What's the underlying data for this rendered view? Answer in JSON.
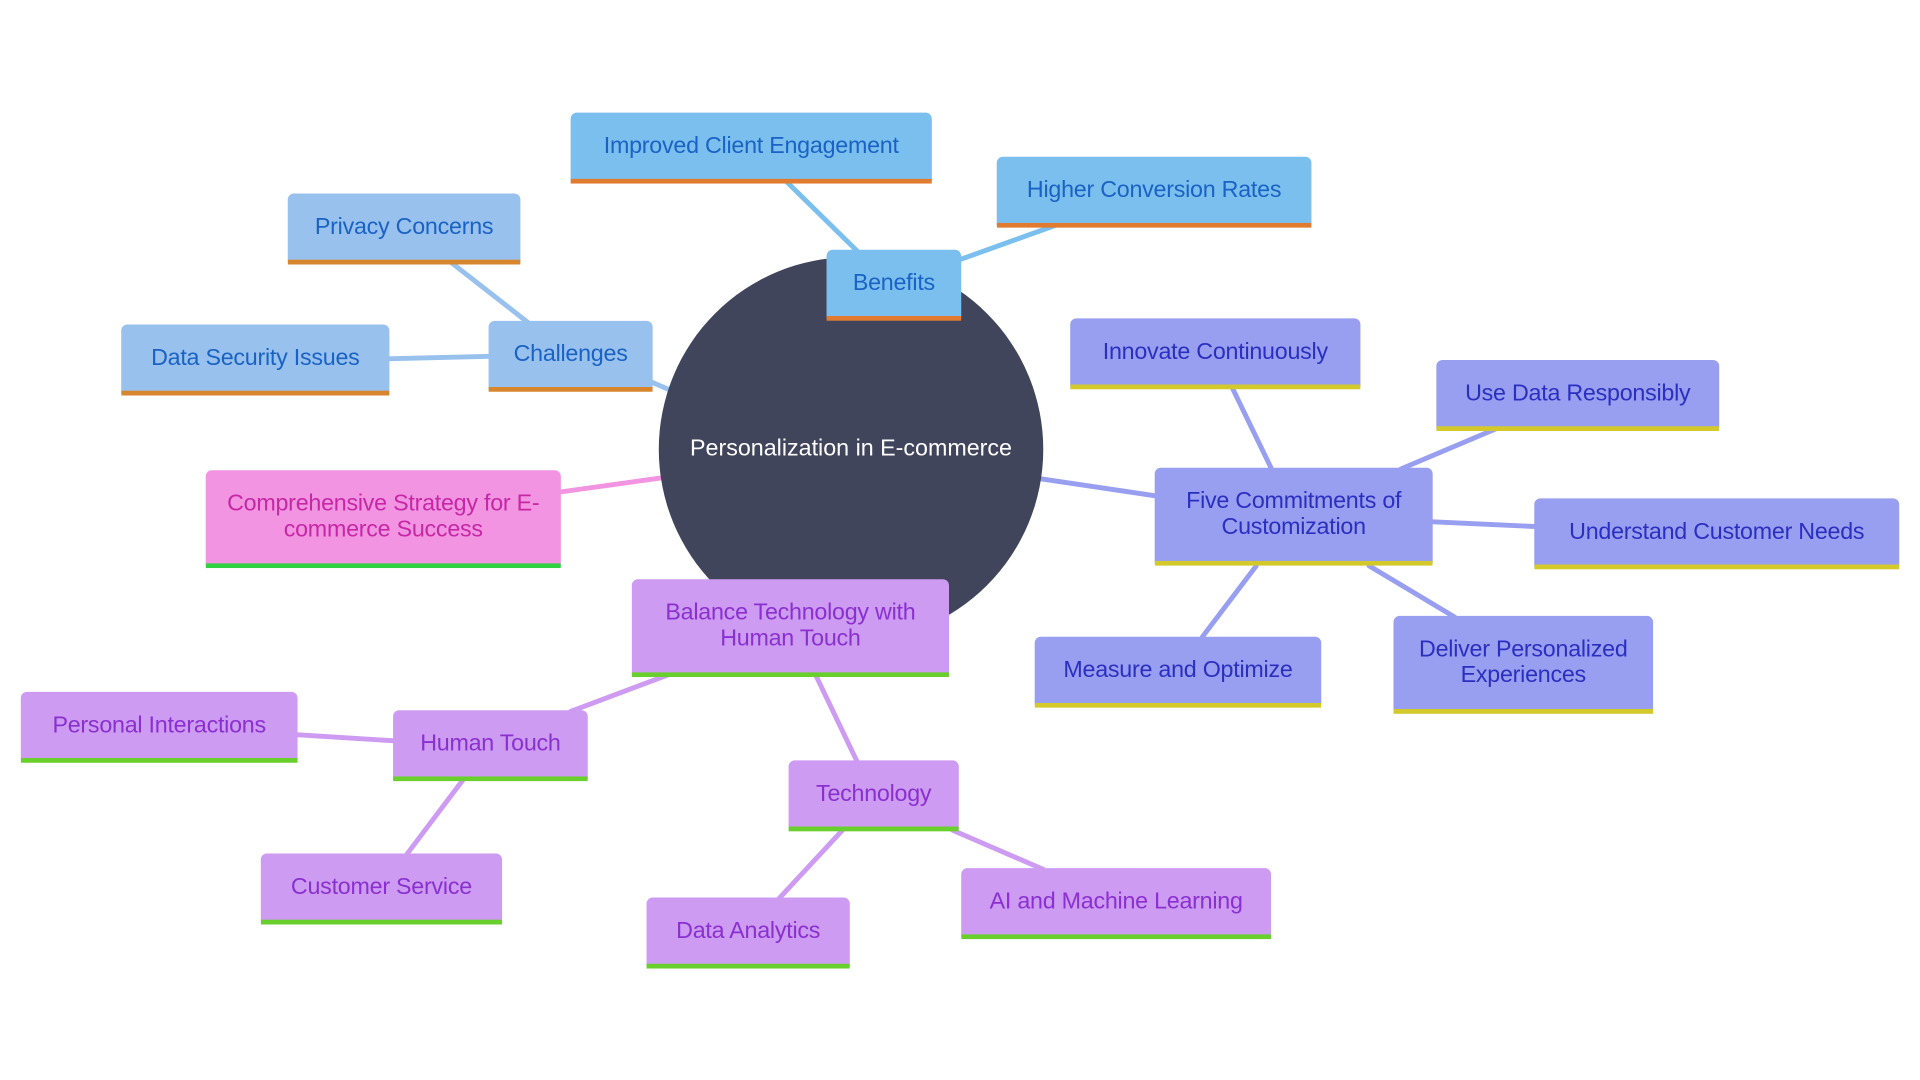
{
  "diagram": {
    "type": "mindmap",
    "root": "Personalization in E-commerce",
    "colors": {
      "root_fill": "#40455c",
      "benefits_fill": "#7bbfee",
      "challenges_fill": "#98c1ee",
      "commitments_fill": "#989ef0",
      "strategy_fill": "#f294e2",
      "balance_fill": "#cd9bf2"
    },
    "nodes": {
      "benefits": "Benefits",
      "improved_engagement": "Improved Client Engagement",
      "higher_conversion": "Higher Conversion Rates",
      "challenges": "Challenges",
      "privacy": "Privacy Concerns",
      "data_security": "Data Security Issues",
      "strategy": "Comprehensive Strategy for E-commerce Success",
      "five_commitments": "Five Commitments of Customization",
      "innovate": "Innovate Continuously",
      "use_data": "Use Data Responsibly",
      "understand": "Understand Customer Needs",
      "deliver": "Deliver Personalized Experiences",
      "measure": "Measure and Optimize",
      "balance": "Balance Technology with Human Touch",
      "human_touch": "Human Touch",
      "personal_interactions": "Personal Interactions",
      "customer_service": "Customer Service",
      "technology": "Technology",
      "data_analytics": "Data Analytics",
      "ai_ml": "AI and Machine Learning"
    }
  }
}
